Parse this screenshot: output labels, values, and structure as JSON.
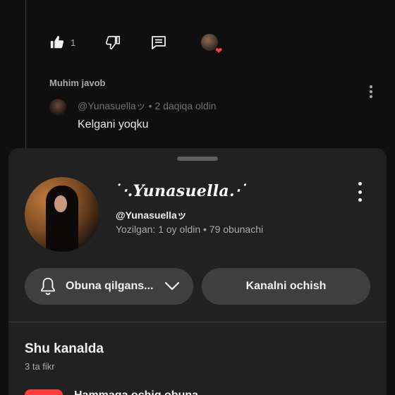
{
  "comment_actions": {
    "like_count": "1"
  },
  "reply_section": {
    "header": "Muhim javob",
    "reply": {
      "author": "@Yunasuellaッ",
      "time": "2 daqiqa oldin",
      "separator": " • ",
      "text": "Kelgani yoqku"
    }
  },
  "channel": {
    "name": "˙‧.Yunasuella.‧˙",
    "handle": "@Yunasuellaッ",
    "meta": "Yozilgan: 1 oy oldin • 79 obunachi"
  },
  "buttons": {
    "subscribed_label": "Obuna qilgans...",
    "open_channel_label": "Kanalni ochish"
  },
  "section": {
    "title": "Shu kanalda",
    "subtitle": "3 ta fikr"
  },
  "playlist": {
    "label": "Hammaga ochiq obuna"
  },
  "icons": [
    "like-icon",
    "dislike-icon",
    "reply-icon",
    "heart-icon",
    "more-vert-icon",
    "bell-icon",
    "chevron-down-icon"
  ],
  "colors": {
    "background": "#0f0f0f",
    "sheet": "#212121",
    "button": "#3f3f3f",
    "heart": "#ff3b5c",
    "accent_red": "#ff3b3b"
  }
}
